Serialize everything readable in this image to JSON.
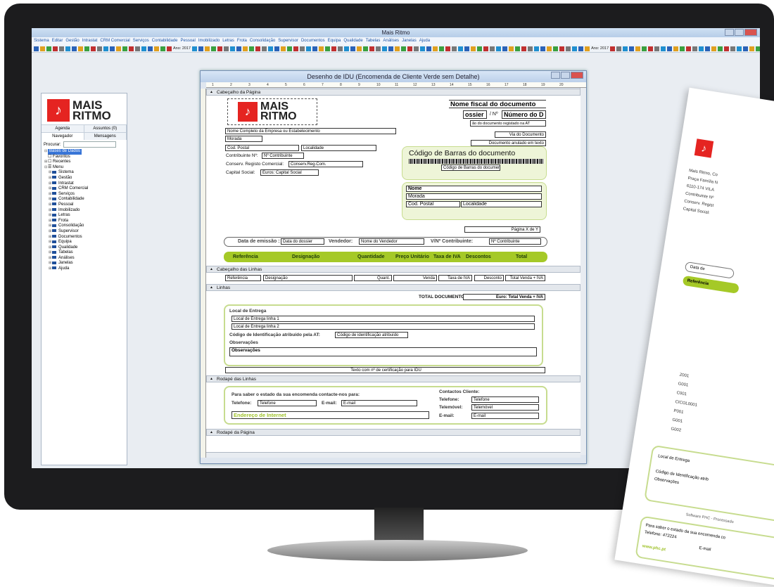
{
  "app": {
    "title": "Mais Ritmo"
  },
  "menu": [
    "Sistema",
    "Editar",
    "Gestão",
    "Intrastat",
    "CRM Comercial",
    "Serviços",
    "Contabilidade",
    "Pessoal",
    "Imobilizado",
    "Letras",
    "Frota",
    "Consolidação",
    "Supervisor",
    "Documentos",
    "Equipa",
    "Qualidade",
    "Tabelas",
    "Análises",
    "Janelas",
    "Ajuda"
  ],
  "toolbar": {
    "year1": "Ano: 2017",
    "year2": "Ano: 2017"
  },
  "left": {
    "logo_line1": "MAIS",
    "logo_line2": "RITMO",
    "tab_agenda": "Agenda",
    "tab_assuntos": "Assuntos (0)",
    "tab_navegador": "Navegador",
    "tab_mensagens": "Mensagens",
    "search_label": "Procurar:",
    "tree_root": "Bases de Dados",
    "tree_fav": "Favoritos",
    "tree_rec": "Recentes",
    "tree_menu": "Menu",
    "items": [
      "Sistema",
      "Gestão",
      "Intrastat",
      "CRM Comercial",
      "Serviços",
      "Contabilidade",
      "Pessoal",
      "Imobilizado",
      "Letras",
      "Frota",
      "Consolidação",
      "Supervisor",
      "Documentos",
      "Equipa",
      "Qualidade",
      "Tabelas",
      "Análises",
      "Janelas",
      "Ajuda"
    ]
  },
  "doc": {
    "title": "Desenho de IDU (Encomenda de Cliente Verde sem Detalhe)",
    "ruler": [
      "1",
      "2",
      "3",
      "4",
      "5",
      "6",
      "7",
      "8",
      "9",
      "10",
      "11",
      "12",
      "13",
      "14",
      "15",
      "16",
      "17",
      "18",
      "19",
      "20"
    ],
    "sec1": "Cabeçalho da Página",
    "sec2": "Cabeçalho das Linhas",
    "sec3": "Linhas",
    "sec4": "Rodapé das Linhas",
    "sec5": "Rodapé da Página",
    "logo1": "MAIS",
    "logo2": "RITMO",
    "nome_fiscal": "Nome fiscal do documento",
    "ossier": "ossier",
    "num_sep": "/ Nº",
    "numero": "Número do D",
    "registado": "ão do documento registado na AT",
    "via": "Via do Documento",
    "anulado": "Documento anulado em texto",
    "empresa": "Nome Completo da Empresa ou Estabelecimento",
    "morada": "Morada",
    "cod_postal": "Cod. Postal",
    "localidade": "Localidade",
    "contrib_lbl": "Contribuinte Nº:",
    "contrib_val": "Nº Contribuinte",
    "conserv_lbl": "Conserv. Registo Comercial:",
    "conserv_val": "Conserv.Reg.Com.",
    "capital_lbl": "Capital Social:",
    "capital_val": "Euros: Capital Social",
    "barcode_title": "Código de Barras do documento",
    "barcode_lbl": "Código de Barras do documento",
    "cli_nome": "Nome",
    "cli_morada": "Morada",
    "cli_cp": "Cod. Postal",
    "cli_loc": "Localidade",
    "pagina": "Página X de Y",
    "emissao_lbl": "Data de emissão :",
    "emissao_val": "Data do dossier",
    "vend_lbl": "Vendedor:",
    "vend_val": "Nome do Vendedor",
    "vn_lbl": "V/Nº Contribuinte:",
    "vn_val": "Nº Contribuinte",
    "cols": [
      "Referência",
      "Designação",
      "Quantidade",
      "Preço Unitário",
      "Taxa de IVA",
      "Descontos",
      "Total"
    ],
    "line_fields": [
      "Referência",
      "Designação",
      "Quant.",
      "Venda",
      "Taxa de IVA",
      "Desconto",
      "Total Venda + IVA"
    ],
    "total_lbl": "TOTAL DOCUMENTO",
    "total_val": "Euro: Total Venda + IVA",
    "local_entrega": "Local de Entrega",
    "le1": "Local de Entrega linha 1",
    "le2": "Local de Entrega linha 2",
    "codigo_lbl": "Código de Identificação atribuído pela AT:",
    "codigo_val": "Código de identificação atribuído",
    "obs_lbl": "Observações",
    "obs_val": "Observações",
    "cert": "Texto com nº de certificação para IDU",
    "saber": "Para saber o estado da sua encomenda contacte-nos para:",
    "tel_lbl": "Telefone:",
    "tel_val": "Telefone",
    "email_lbl": "E-mail:",
    "email_val": "E-mail",
    "endereco": "Endereço de Internet",
    "contactos": "Contactos Cliente:",
    "c_tel_lbl": "Telefone:",
    "c_tel_val": "Telefone",
    "c_tm_lbl": "Telemóvel:",
    "c_tm_val": "Telemóvel",
    "c_em_lbl": "E-mail:",
    "c_em_val": "E-mail"
  },
  "paper": {
    "l1": "Mais Ritmo, Co",
    "l2": "Praça Família N",
    "l3": "6110-174 VILA",
    "l4": "Contribuinte Nº",
    "l5": "Conserv. Regist",
    "l6": "Capital Social:",
    "data": "Data de",
    "ref": "Referência",
    "c1": "Z001",
    "c2": "G001",
    "c3": "C001",
    "c4": "CICOL0001",
    "c5": "P001",
    "c6": "G001",
    "c7": "G002",
    "local": "Local de Entrega",
    "codigo": "Código de Identificação atrib",
    "obs": "Observações",
    "software": "Software PHC - Processado",
    "saber": "Para saber o estado da sua encomenda co",
    "tel": "Telefone: 472224",
    "email": "E-mail",
    "web": "www.phc.pt"
  },
  "colors": {
    "green_bar": "#a5c927",
    "green_fill": "#eef5d8",
    "logo_red": "#e52421"
  }
}
